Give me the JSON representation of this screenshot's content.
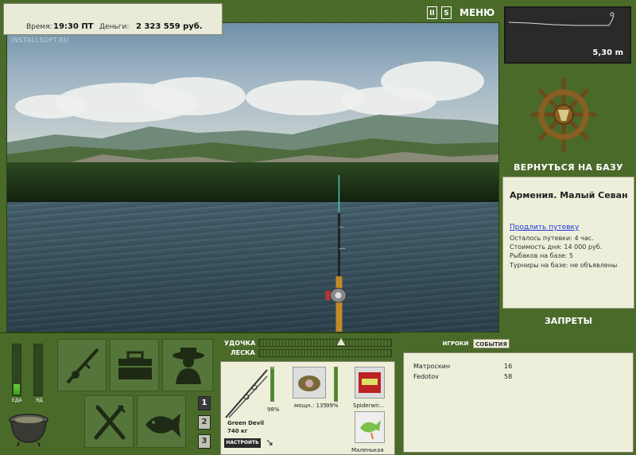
{
  "status": {
    "time_label": "Время:",
    "time_value": "19:30 ПТ",
    "money_label": "Деньги:",
    "money_value": "2 323 559 руб."
  },
  "watermark": "INSTALLSOFT.RU",
  "controls": {
    "pause_label": "II",
    "sound_label": "S",
    "menu_label": "МЕНЮ"
  },
  "depth": {
    "value": "5,30 m"
  },
  "base": {
    "back_label": "ВЕРНУТЬСЯ НА БАЗУ",
    "location": "Армения. Малый Севан",
    "extend_link": "Продлить путевку",
    "lines": [
      "Осталось путевки: 4 час.",
      "Стоимость дня: 14 000 руб.",
      "Рыбаков на базе: 5",
      "Турниры на базе: не объявлены"
    ],
    "bans_label": "ЗАПРЕТЫ"
  },
  "meters": {
    "food_label": "ЕДА",
    "poison_label": "ЯД",
    "food_level": 0.2,
    "poison_level": 0.0
  },
  "slots": {
    "numbers": [
      "1",
      "2",
      "3"
    ],
    "active": "1"
  },
  "tackle": {
    "rod_label": "УДОЧКА",
    "line_label": "ЛЕСКА",
    "rod_name": "Green Devil",
    "rod_weight": "740 кг",
    "rod_percent": "98%",
    "reel_text": "мощн.: 135",
    "reel_percent": "99%",
    "line_name": "Spiderwir...",
    "bait_name": "Маленькая",
    "setup_label": "НАСТРОИТЬ",
    "rod_level": 0.98,
    "reel_level": 0.99
  },
  "players": {
    "tab_players": "ИГРОКИ",
    "tab_events": "СОБЫТИЯ",
    "rows": [
      {
        "name": "Матроскин",
        "score": "16"
      },
      {
        "name": "Fedotov",
        "score": "58"
      }
    ]
  }
}
